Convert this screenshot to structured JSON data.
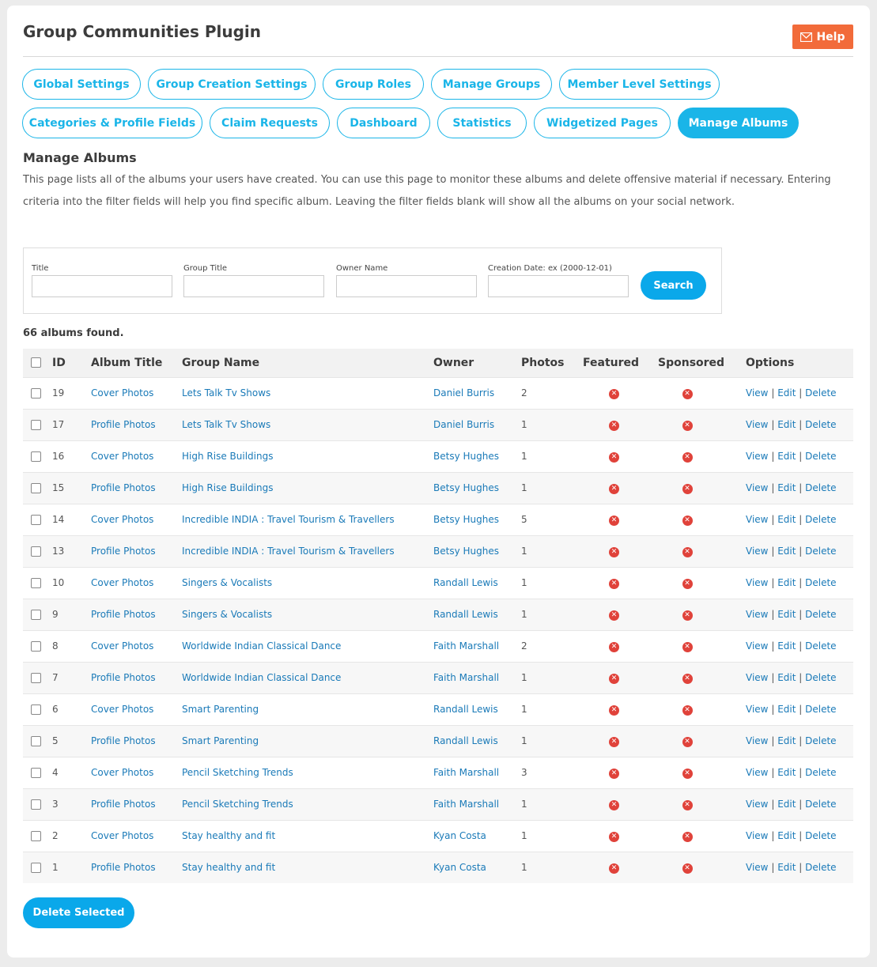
{
  "page": {
    "title": "Group Communities Plugin",
    "help_label": "Help"
  },
  "tabs_row1": [
    {
      "label": "Global Settings",
      "active": false
    },
    {
      "label": "Group Creation Settings",
      "active": false
    },
    {
      "label": "Group Roles",
      "active": false
    },
    {
      "label": "Manage Groups",
      "active": false
    },
    {
      "label": "Member Level Settings",
      "active": false
    }
  ],
  "tabs_row2": [
    {
      "label": "Categories & Profile Fields",
      "active": false
    },
    {
      "label": "Claim Requests",
      "active": false
    },
    {
      "label": "Dashboard",
      "active": false
    },
    {
      "label": "Statistics",
      "active": false
    },
    {
      "label": "Widgetized Pages",
      "active": false
    },
    {
      "label": "Manage Albums",
      "active": true
    }
  ],
  "section": {
    "title": "Manage Albums",
    "description": "This page lists all of the albums your users have created. You can use this page to monitor these albums and delete offensive material if necessary. Entering criteria into the filter fields will help you find specific album. Leaving the filter fields blank will show all the albums on your social network."
  },
  "filter": {
    "title_label": "Title",
    "title_value": "",
    "group_title_label": "Group Title",
    "group_title_value": "",
    "owner_label": "Owner Name",
    "owner_value": "",
    "date_label": "Creation Date: ex (2000-12-01)",
    "date_value": "",
    "search_label": "Search"
  },
  "results": {
    "found_text": "66 albums found."
  },
  "table": {
    "headers": {
      "id": "ID",
      "album_title": "Album Title",
      "group_name": "Group Name",
      "owner": "Owner",
      "photos": "Photos",
      "featured": "Featured",
      "sponsored": "Sponsored",
      "options": "Options"
    },
    "option_labels": {
      "view": "View",
      "edit": "Edit",
      "delete": "Delete",
      "separator": "|"
    },
    "status_icon": "x-circle-icon",
    "rows": [
      {
        "id": "19",
        "album": "Cover Photos",
        "group": "Lets Talk Tv Shows",
        "owner": "Daniel Burris",
        "photos": "2"
      },
      {
        "id": "17",
        "album": "Profile Photos",
        "group": "Lets Talk Tv Shows",
        "owner": "Daniel Burris",
        "photos": "1"
      },
      {
        "id": "16",
        "album": "Cover Photos",
        "group": "High Rise Buildings",
        "owner": "Betsy Hughes",
        "photos": "1"
      },
      {
        "id": "15",
        "album": "Profile Photos",
        "group": "High Rise Buildings",
        "owner": "Betsy Hughes",
        "photos": "1"
      },
      {
        "id": "14",
        "album": "Cover Photos",
        "group": "Incredible INDIA : Travel Tourism & Travellers",
        "owner": "Betsy Hughes",
        "photos": "5"
      },
      {
        "id": "13",
        "album": "Profile Photos",
        "group": "Incredible INDIA : Travel Tourism & Travellers",
        "owner": "Betsy Hughes",
        "photos": "1"
      },
      {
        "id": "10",
        "album": "Cover Photos",
        "group": "Singers & Vocalists",
        "owner": "Randall Lewis",
        "photos": "1"
      },
      {
        "id": "9",
        "album": "Profile Photos",
        "group": "Singers & Vocalists",
        "owner": "Randall Lewis",
        "photos": "1"
      },
      {
        "id": "8",
        "album": "Cover Photos",
        "group": "Worldwide Indian Classical Dance",
        "owner": "Faith Marshall",
        "photos": "2"
      },
      {
        "id": "7",
        "album": "Profile Photos",
        "group": "Worldwide Indian Classical Dance",
        "owner": "Faith Marshall",
        "photos": "1"
      },
      {
        "id": "6",
        "album": "Cover Photos",
        "group": "Smart Parenting",
        "owner": "Randall Lewis",
        "photos": "1"
      },
      {
        "id": "5",
        "album": "Profile Photos",
        "group": "Smart Parenting",
        "owner": "Randall Lewis",
        "photos": "1"
      },
      {
        "id": "4",
        "album": "Cover Photos",
        "group": "Pencil Sketching Trends",
        "owner": "Faith Marshall",
        "photos": "3"
      },
      {
        "id": "3",
        "album": "Profile Photos",
        "group": "Pencil Sketching Trends",
        "owner": "Faith Marshall",
        "photos": "1"
      },
      {
        "id": "2",
        "album": "Cover Photos",
        "group": "Stay healthy and fit",
        "owner": "Kyan Costa",
        "photos": "1"
      },
      {
        "id": "1",
        "album": "Profile Photos",
        "group": "Stay healthy and fit",
        "owner": "Kyan Costa",
        "photos": "1"
      }
    ]
  },
  "actions": {
    "delete_selected_label": "Delete Selected"
  },
  "colors": {
    "accent": "#1ab5e8",
    "button": "#0aa8ea",
    "help": "#f26b3a",
    "link": "#1a7ab8",
    "no_status": "#e0423a"
  }
}
